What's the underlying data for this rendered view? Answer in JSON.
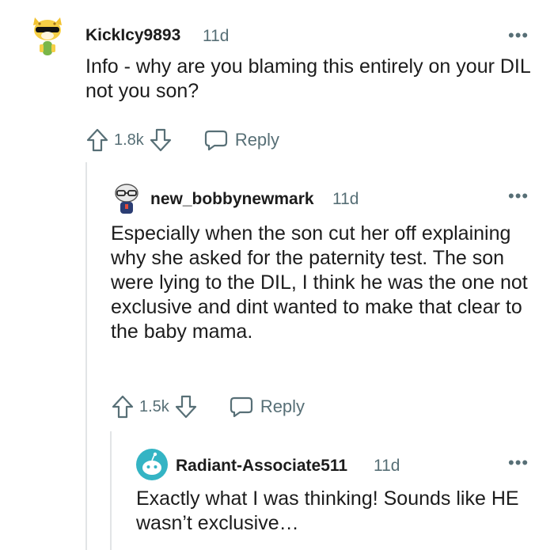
{
  "comments": [
    {
      "username": "KickIcy9893",
      "age": "11d",
      "body": "Info - why are you blaming this entirely on your DIL not you son?",
      "score": "1.8k",
      "reply_label": "Reply",
      "more_label": "•••",
      "avatar_icon": "cheetah-sunglasses-avatar-icon"
    },
    {
      "username": "new_bobbynewmark",
      "age": "11d",
      "body": "Especially when the son cut her off explaining why she asked for the paternity test. The son were lying to the DIL, I think he was the one not exclusive and dint wanted to make that clear to the baby mama.",
      "score": "1.5k",
      "reply_label": "Reply",
      "more_label": "•••",
      "avatar_icon": "glasses-snoo-avatar-icon"
    },
    {
      "username": "Radiant-Associate511",
      "age": "11d",
      "body": "Exactly what I was thinking! Sounds like HE wasn’t exclusive…",
      "more_label": "•••",
      "avatar_icon": "default-snoo-avatar-icon"
    }
  ],
  "colors": {
    "text": "#1c1c1c",
    "meta": "#576f76",
    "thread_line": "#e2e4e6",
    "avatar_teal": "#34b4c4"
  }
}
